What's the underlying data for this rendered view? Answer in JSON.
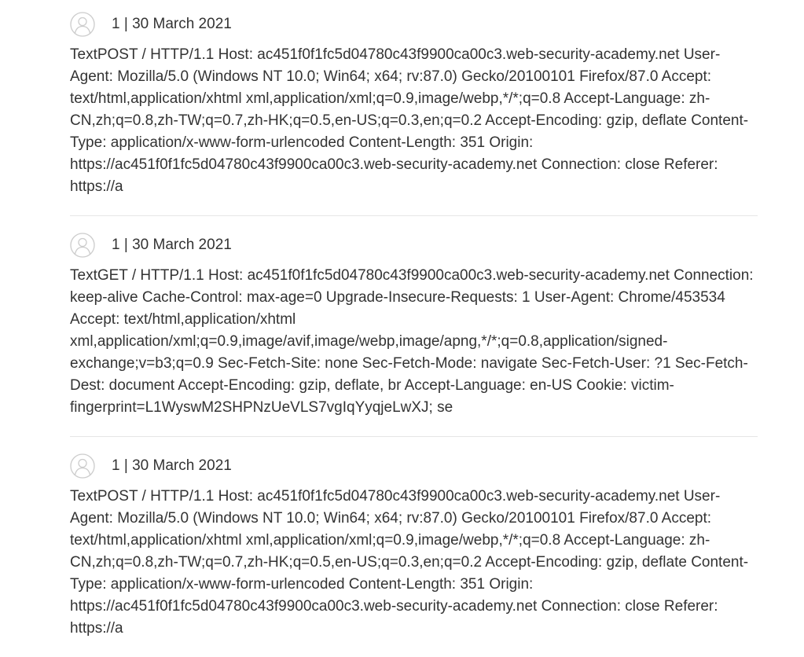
{
  "comments": [
    {
      "author": "1",
      "separator": " | ",
      "date": "30 March 2021",
      "body": "TextPOST / HTTP/1.1 Host: ac451f0f1fc5d04780c43f9900ca00c3.web-security-academy.net User-Agent: Mozilla/5.0 (Windows NT 10.0; Win64; x64; rv:87.0) Gecko/20100101 Firefox/87.0 Accept: text/html,application/xhtml xml,application/xml;q=0.9,image/webp,*/*;q=0.8 Accept-Language: zh-CN,zh;q=0.8,zh-TW;q=0.7,zh-HK;q=0.5,en-US;q=0.3,en;q=0.2 Accept-Encoding: gzip, deflate Content-Type: application/x-www-form-urlencoded Content-Length: 351 Origin: https://ac451f0f1fc5d04780c43f9900ca00c3.web-security-academy.net Connection: close Referer: https://a"
    },
    {
      "author": "1",
      "separator": " | ",
      "date": "30 March 2021",
      "body": "TextGET / HTTP/1.1 Host: ac451f0f1fc5d04780c43f9900ca00c3.web-security-academy.net Connection: keep-alive Cache-Control: max-age=0 Upgrade-Insecure-Requests: 1 User-Agent: Chrome/453534 Accept: text/html,application/xhtml xml,application/xml;q=0.9,image/avif,image/webp,image/apng,*/*;q=0.8,application/signed-exchange;v=b3;q=0.9 Sec-Fetch-Site: none Sec-Fetch-Mode: navigate Sec-Fetch-User: ?1 Sec-Fetch-Dest: document Accept-Encoding: gzip, deflate, br Accept-Language: en-US Cookie: victim-fingerprint=L1WyswM2SHPNzUeVLS7vgIqYyqjeLwXJ; se"
    },
    {
      "author": "1",
      "separator": " | ",
      "date": "30 March 2021",
      "body": "TextPOST / HTTP/1.1 Host: ac451f0f1fc5d04780c43f9900ca00c3.web-security-academy.net User-Agent: Mozilla/5.0 (Windows NT 10.0; Win64; x64; rv:87.0) Gecko/20100101 Firefox/87.0 Accept: text/html,application/xhtml xml,application/xml;q=0.9,image/webp,*/*;q=0.8 Accept-Language: zh-CN,zh;q=0.8,zh-TW;q=0.7,zh-HK;q=0.5,en-US;q=0.3,en;q=0.2 Accept-Encoding: gzip, deflate Content-Type: application/x-www-form-urlencoded Content-Length: 351 Origin: https://ac451f0f1fc5d04780c43f9900ca00c3.web-security-academy.net Connection: close Referer: https://a"
    }
  ],
  "avatar_icon": "user-avatar-icon",
  "colors": {
    "text": "#333333",
    "avatar_stroke": "#cccccc",
    "divider": "#e6e6e6"
  }
}
